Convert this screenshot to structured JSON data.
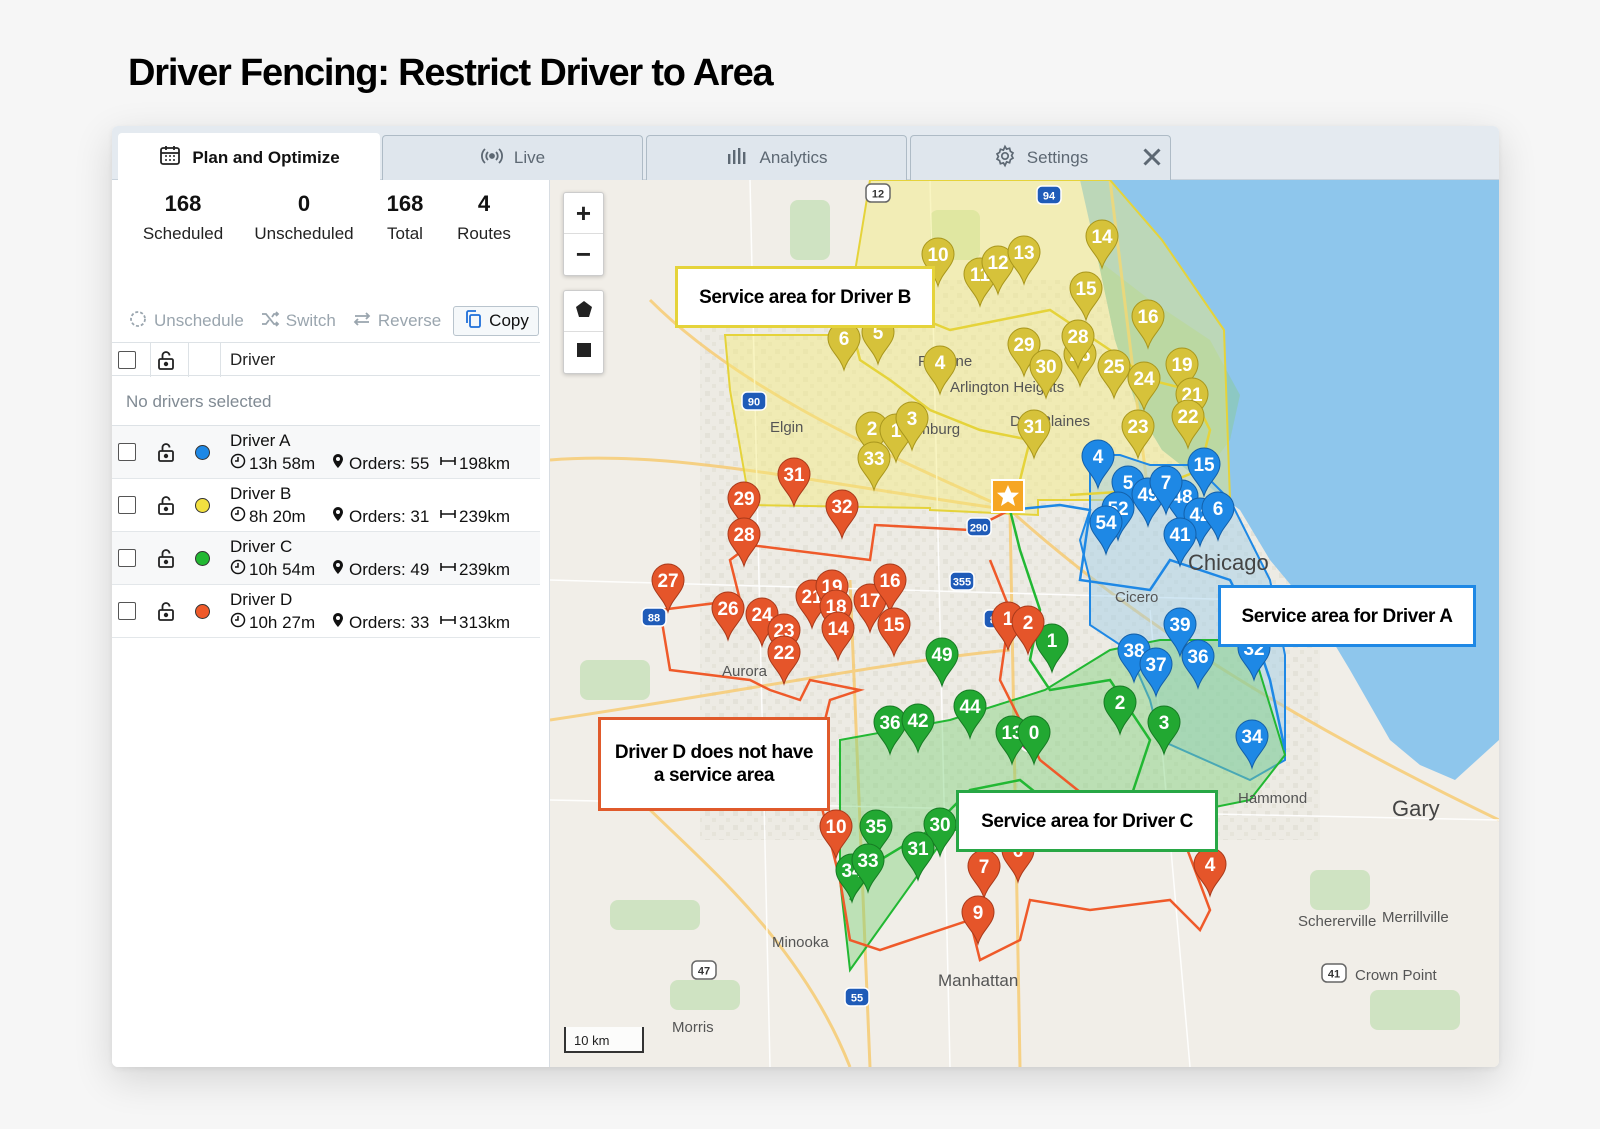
{
  "page": {
    "title": "Driver Fencing: Restrict Driver to Area"
  },
  "tabs": [
    {
      "label": "Plan and Optimize",
      "icon": "calendar-icon",
      "active": true
    },
    {
      "label": "Live",
      "icon": "broadcast-icon",
      "active": false
    },
    {
      "label": "Analytics",
      "icon": "bar-chart-icon",
      "active": false
    },
    {
      "label": "Settings",
      "icon": "gear-icon",
      "active": false
    }
  ],
  "stats": [
    {
      "value": "168",
      "label": "Scheduled"
    },
    {
      "value": "0",
      "label": "Unscheduled"
    },
    {
      "value": "168",
      "label": "Total"
    },
    {
      "value": "4",
      "label": "Routes"
    }
  ],
  "actions": {
    "unschedule": "Unschedule",
    "switch": "Switch",
    "reverse": "Reverse",
    "copy": "Copy"
  },
  "table": {
    "header": "Driver",
    "empty": "No drivers selected",
    "drivers": [
      {
        "name": "Driver A",
        "time": "13h 58m",
        "orders": "Orders: 55",
        "distance": "198km",
        "color": "#1e88e5"
      },
      {
        "name": "Driver B",
        "time": "8h 20m",
        "orders": "Orders: 31",
        "distance": "239km",
        "color": "#f2e040"
      },
      {
        "name": "Driver C",
        "time": "10h 54m",
        "orders": "Orders: 49",
        "distance": "239km",
        "color": "#22b833"
      },
      {
        "name": "Driver D",
        "time": "10h 27m",
        "orders": "Orders: 33",
        "distance": "313km",
        "color": "#ef5a2a"
      }
    ]
  },
  "map": {
    "scale": "10 km",
    "zoom_in": "+",
    "zoom_out": "−",
    "places": {
      "palatine": "Palatine",
      "elgin": "Elgin",
      "schaumburg": "Schaumburg",
      "arlington": "Arlington Heights",
      "desplaines": "Des Plaines",
      "chicago": "Chicago",
      "cicero": "Cicero",
      "hammond": "Hammond",
      "gary": "Gary",
      "minooka": "Minooka",
      "manhattan": "Manhattan",
      "schererville": "Schererville",
      "merrillville": "Merrillville",
      "crownpoint": "Crown Point",
      "morris": "Morris",
      "aurora": "Aurora"
    },
    "highway_shields": [
      "12",
      "94",
      "90",
      "290",
      "355",
      "88",
      "88",
      "47",
      "55",
      "41"
    ],
    "callouts": {
      "driver_b": "Service area for Driver B",
      "driver_a": "Service area for Driver A",
      "driver_c": "Service area for Driver C",
      "driver_d": "Driver D does not have a service area"
    },
    "pins_b": [
      "10",
      "11",
      "12",
      "13",
      "14",
      "15",
      "16",
      "6",
      "5",
      "4",
      "29",
      "30",
      "26",
      "28",
      "25",
      "24",
      "19",
      "21",
      "22",
      "23",
      "31",
      "2",
      "1",
      "3",
      "33"
    ],
    "pins_a": [
      "4",
      "5",
      "52",
      "49",
      "48",
      "7",
      "42",
      "6",
      "54",
      "41",
      "15",
      "39",
      "38",
      "37",
      "36",
      "32",
      "34"
    ],
    "pins_c": [
      "49",
      "36",
      "42",
      "44",
      "13",
      "0",
      "2",
      "3",
      "1",
      "35",
      "30",
      "31",
      "34",
      "33"
    ],
    "pins_d": [
      "31",
      "29",
      "28",
      "32",
      "27",
      "26",
      "24",
      "23",
      "22",
      "21",
      "19",
      "18",
      "17",
      "16",
      "15",
      "14",
      "1",
      "2",
      "10",
      "7",
      "6",
      "9",
      "4"
    ]
  }
}
